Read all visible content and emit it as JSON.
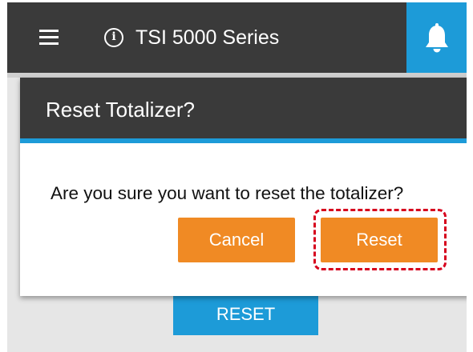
{
  "app_bar": {
    "title": "TSI 5000 Series",
    "menu_icon": "hamburger-menu-icon",
    "info_icon": "info-icon",
    "info_glyph": "i",
    "bell_icon": "bell-icon",
    "colors": {
      "bar": "#3a3a3a",
      "accent": "#1d9bd8"
    }
  },
  "dialog": {
    "title": "Reset Totalizer?",
    "message": "Are you sure you want to reset the totalizer?",
    "cancel_label": "Cancel",
    "reset_label": "Reset",
    "colors": {
      "button": "#f08a24",
      "highlight": "#d6001c"
    }
  },
  "page": {
    "reset_button_label": "RESET"
  }
}
